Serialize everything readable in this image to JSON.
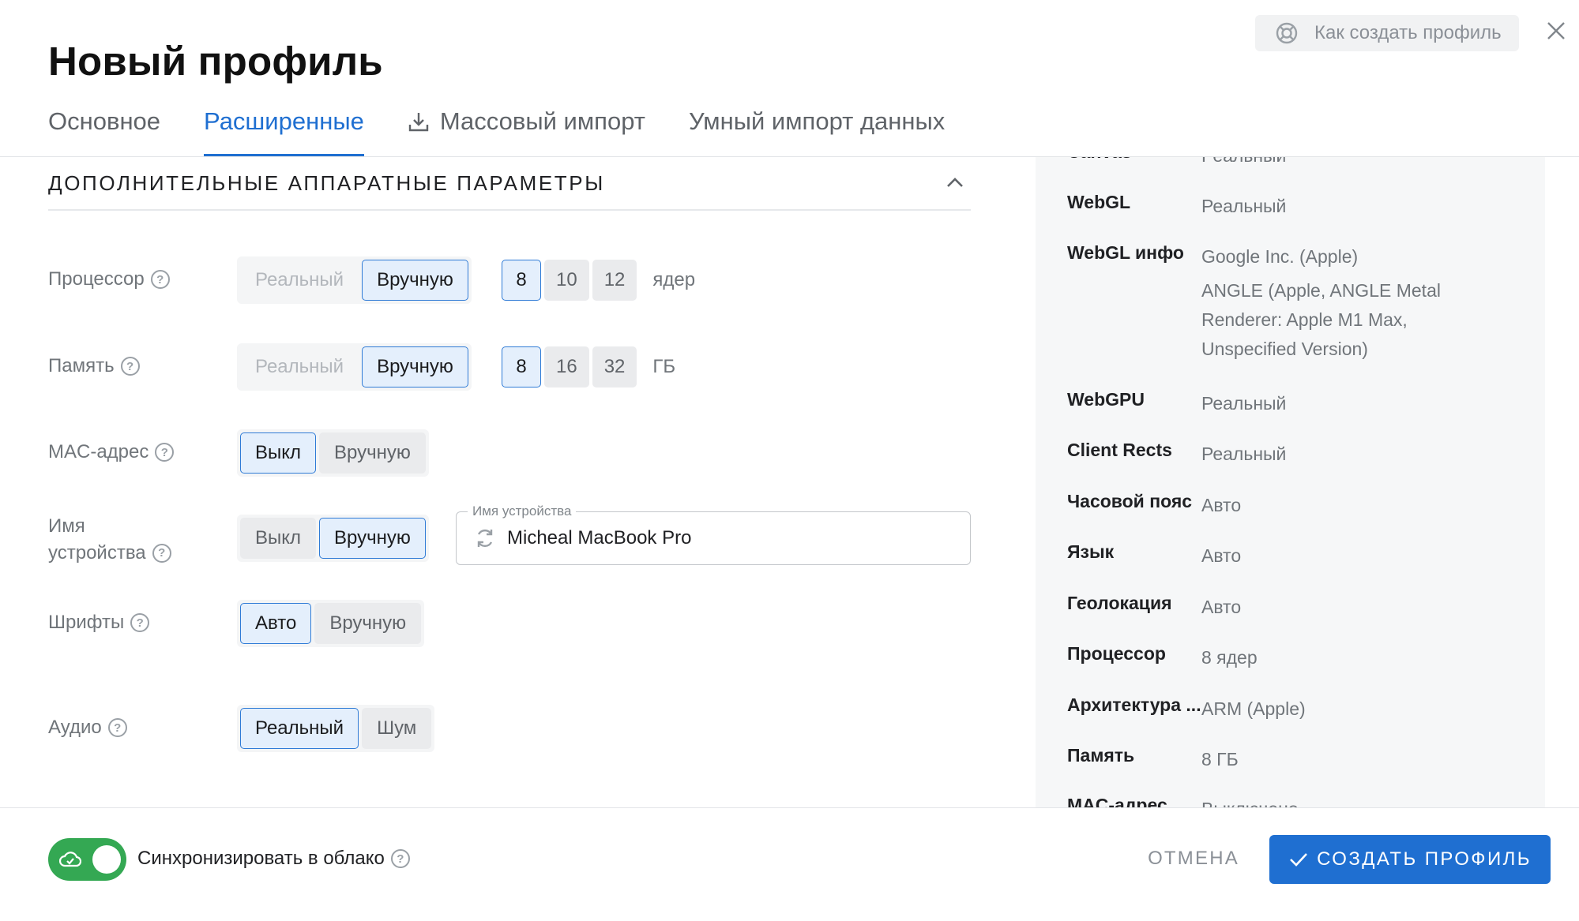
{
  "header": {
    "title": "Новый профиль",
    "help_label": "Как создать профиль"
  },
  "tabs": [
    {
      "label": "Основное",
      "active": false
    },
    {
      "label": "Расширенные",
      "active": true
    },
    {
      "label": "Массовый импорт",
      "icon": "download-icon",
      "active": false
    },
    {
      "label": "Умный импорт данных",
      "active": false
    }
  ],
  "section": {
    "title": "ДОПОЛНИТЕЛЬНЫЕ АППАРАТНЫЕ ПАРАМЕТРЫ"
  },
  "params": {
    "cpu": {
      "label": "Процессор",
      "mode_real": "Реальный",
      "mode_manual": "Вручную",
      "selected": "Вручную",
      "options": [
        "8",
        "10",
        "12"
      ],
      "selected_value": "8",
      "unit": "ядер"
    },
    "memory": {
      "label": "Память",
      "mode_real": "Реальный",
      "mode_manual": "Вручную",
      "selected": "Вручную",
      "options": [
        "8",
        "16",
        "32"
      ],
      "selected_value": "8",
      "unit": "ГБ"
    },
    "mac": {
      "label": "MAC-адрес",
      "opt_off": "Выкл",
      "opt_manual": "Вручную",
      "selected": "Выкл"
    },
    "device_name": {
      "label_line1": "Имя",
      "label_line2": "устройства",
      "opt_off": "Выкл",
      "opt_manual": "Вручную",
      "selected": "Вручную",
      "field_label": "Имя устройства",
      "value": "Micheal MacBook Pro"
    },
    "fonts": {
      "label": "Шрифты",
      "opt_auto": "Авто",
      "opt_manual": "Вручную",
      "selected": "Авто"
    },
    "audio": {
      "label": "Аудио",
      "opt_real": "Реальный",
      "opt_noise": "Шум",
      "selected": "Реальный"
    }
  },
  "summary": {
    "rows": [
      {
        "key": "Canvas",
        "value": "Реальный"
      },
      {
        "key": "WebGL",
        "value": "Реальный"
      },
      {
        "key": "WebGL инфо",
        "value": "Google Inc. (Apple)",
        "value2": "ANGLE (Apple, ANGLE Metal Renderer: Apple M1 Max, Unspecified Version)"
      },
      {
        "key": "WebGPU",
        "value": "Реальный"
      },
      {
        "key": "Client Rects",
        "value": "Реальный"
      },
      {
        "key": "Часовой пояс",
        "value": "Авто"
      },
      {
        "key": "Язык",
        "value": "Авто"
      },
      {
        "key": "Геолокация",
        "value": "Авто"
      },
      {
        "key": "Процессор",
        "value": "8 ядер"
      },
      {
        "key": "Архитектура ...",
        "value": "ARM (Apple)"
      },
      {
        "key": "Память",
        "value": "8 ГБ"
      },
      {
        "key": "MAC-адрес",
        "value": "Выключено"
      }
    ]
  },
  "footer": {
    "sync_label": "Синхронизировать в облако",
    "sync_enabled": true,
    "cancel_label": "ОТМЕНА",
    "create_label": "СОЗДАТЬ ПРОФИЛЬ"
  },
  "colors": {
    "accent": "#1f6fd1",
    "toggle_on": "#34a853",
    "selected_bg": "#e4effc"
  }
}
